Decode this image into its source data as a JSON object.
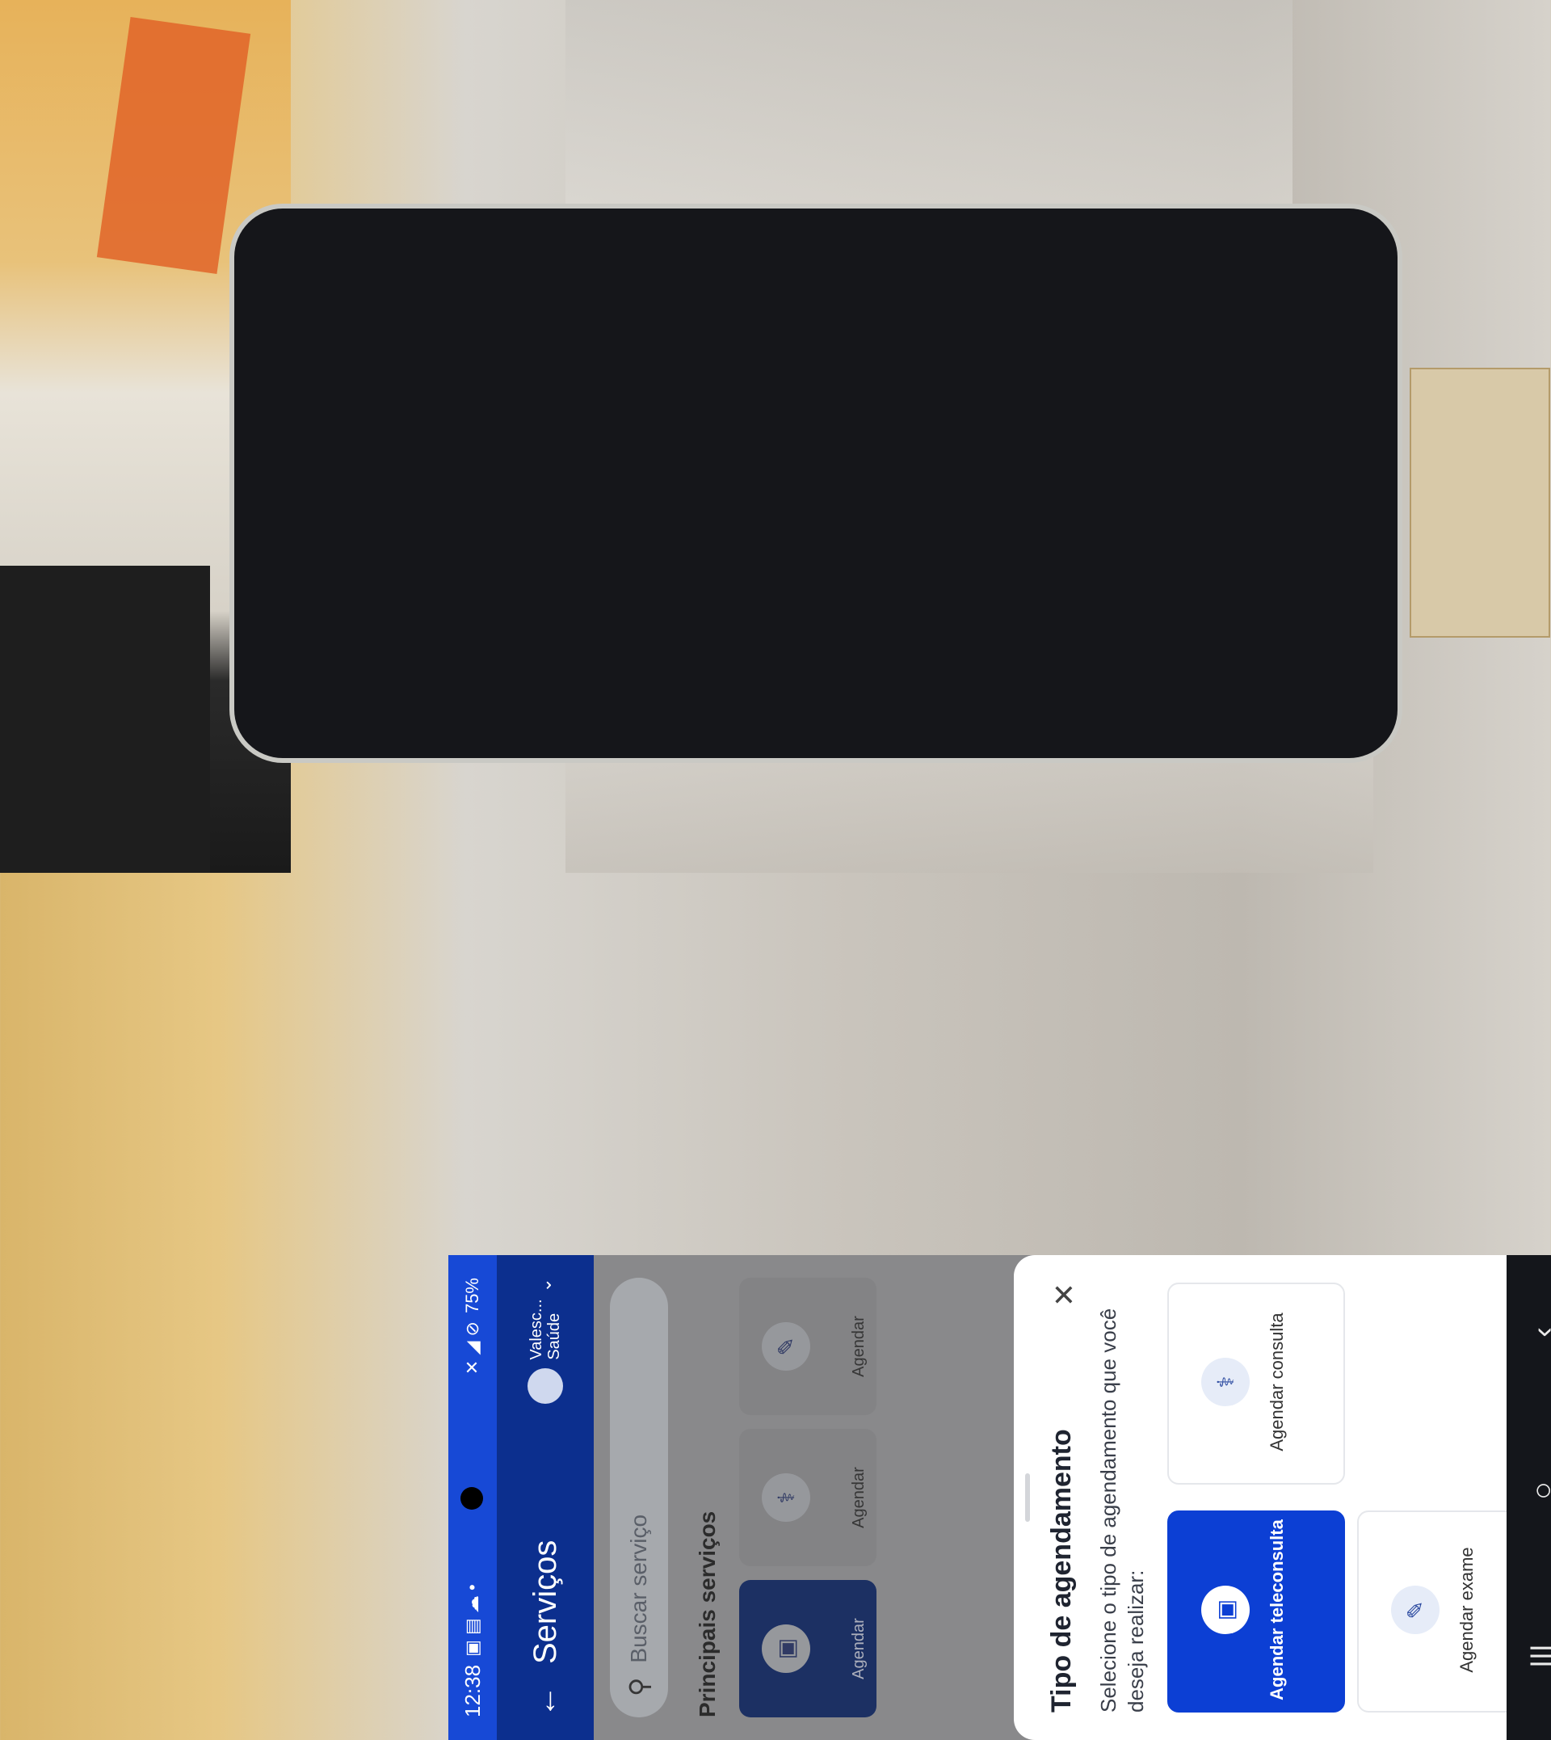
{
  "status_bar": {
    "time": "12:38",
    "battery": "75%"
  },
  "app_bar": {
    "title": "Serviços",
    "user_name": "Valesc...",
    "user_sub": "Saúde"
  },
  "search": {
    "placeholder": "Buscar serviço"
  },
  "main": {
    "section_title": "Principais serviços",
    "services": [
      {
        "label": "Agendar"
      },
      {
        "label": "Agendar"
      },
      {
        "label": "Agendar"
      }
    ]
  },
  "sheet": {
    "title": "Tipo de agendamento",
    "description": "Selecione o tipo de agendamento que você deseja realizar:",
    "options": [
      {
        "label": "Agendar teleconsulta",
        "icon": "teleconsulta-icon",
        "selected": true
      },
      {
        "label": "Agendar consulta",
        "icon": "stethoscope-icon",
        "selected": false
      },
      {
        "label": "Agendar exame",
        "icon": "syringe-icon",
        "selected": false
      }
    ]
  },
  "colors": {
    "primary": "#0c3fd4",
    "appbar": "#0c2f8e"
  }
}
